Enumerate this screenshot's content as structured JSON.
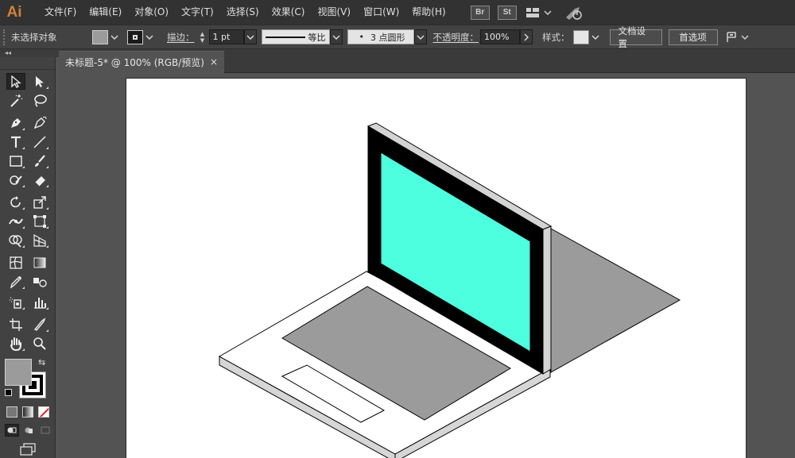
{
  "app": {
    "logo": "Ai"
  },
  "menu": [
    "文件(F)",
    "编辑(E)",
    "对象(O)",
    "文字(T)",
    "选择(S)",
    "效果(C)",
    "视图(V)",
    "窗口(W)",
    "帮助(H)"
  ],
  "menubar_icons": {
    "bridge": "Br",
    "stock": "St"
  },
  "control_bar": {
    "selection_status": "未选择对象",
    "stroke_label": "描边",
    "stroke_weight": "1 pt",
    "profile_label": "等比",
    "brush_label": "3 点圆形",
    "opacity_label": "不透明度",
    "opacity_value": "100%",
    "style_label": "样式",
    "doc_setup_button": "文档设置",
    "preferences_button": "首选项"
  },
  "document": {
    "tab_title": "未标题-5* @ 100% (RGB/预览)",
    "close_glyph": "×"
  },
  "colors": {
    "fill": "#9b9b9b",
    "screen": "#4dffdf",
    "bezel": "#000000",
    "keyboard_area": "#9b9b9b",
    "shadow": "#9b9b9b",
    "lid_edge": "#d4d4d4",
    "base_top": "#ffffff"
  },
  "tools": [
    "selection-tool",
    "direct-selection-tool",
    "magic-wand-tool",
    "lasso-tool",
    "pen-tool",
    "curvature-tool",
    "type-tool",
    "line-segment-tool",
    "rectangle-tool",
    "paintbrush-tool",
    "shaper-tool",
    "eraser-tool",
    "rotate-tool",
    "scale-tool",
    "width-tool",
    "free-transform-tool",
    "shape-builder-tool",
    "perspective-grid-tool",
    "mesh-tool",
    "gradient-tool",
    "eyedropper-tool",
    "blend-tool",
    "symbol-sprayer-tool",
    "column-graph-tool",
    "artboard-tool",
    "slice-tool",
    "hand-tool",
    "zoom-tool"
  ]
}
